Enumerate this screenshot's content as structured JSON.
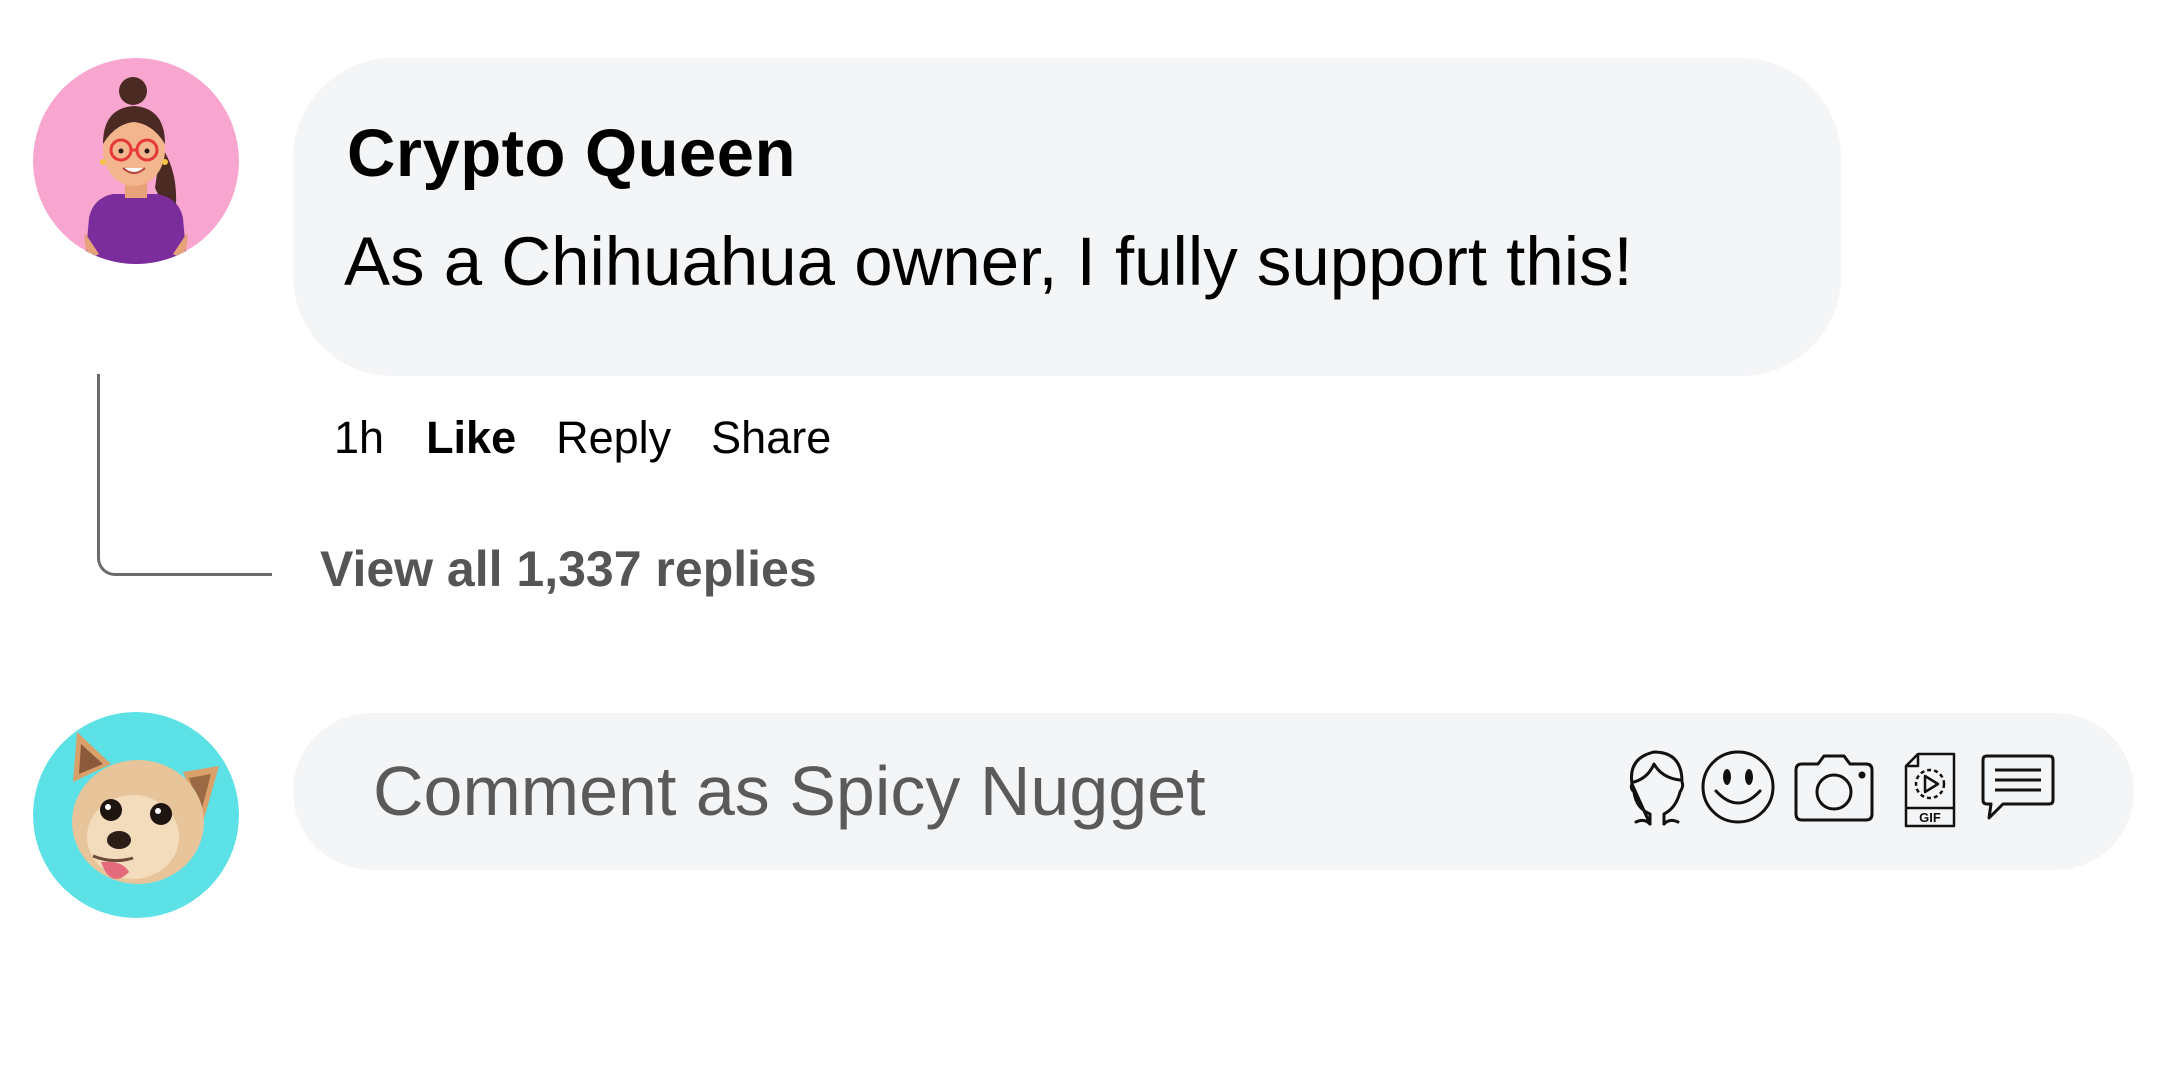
{
  "comment": {
    "author": "Crypto Queen",
    "text": "As a Chihuahua owner, I fully support this!",
    "actions": {
      "time": "1h",
      "like": "Like",
      "reply": "Reply",
      "share": "Share"
    },
    "view_replies": "View all 1,337 replies",
    "avatar": {
      "icon": "woman-avatar-illustration",
      "background": "#f8a5cf"
    }
  },
  "composer": {
    "placeholder": "Comment as Spicy Nugget",
    "avatar": {
      "icon": "chihuahua-photo",
      "background": "#5ce1e6"
    },
    "tools": [
      {
        "icon": "avatar-sticker-icon"
      },
      {
        "icon": "emoji-icon"
      },
      {
        "icon": "camera-icon"
      },
      {
        "icon": "gif-icon",
        "label": "GIF"
      },
      {
        "icon": "sticker-icon"
      }
    ]
  },
  "colors": {
    "bubble": "#f4f5f7",
    "secondary_text": "#555555",
    "thread_line": "#6b6b6b"
  }
}
